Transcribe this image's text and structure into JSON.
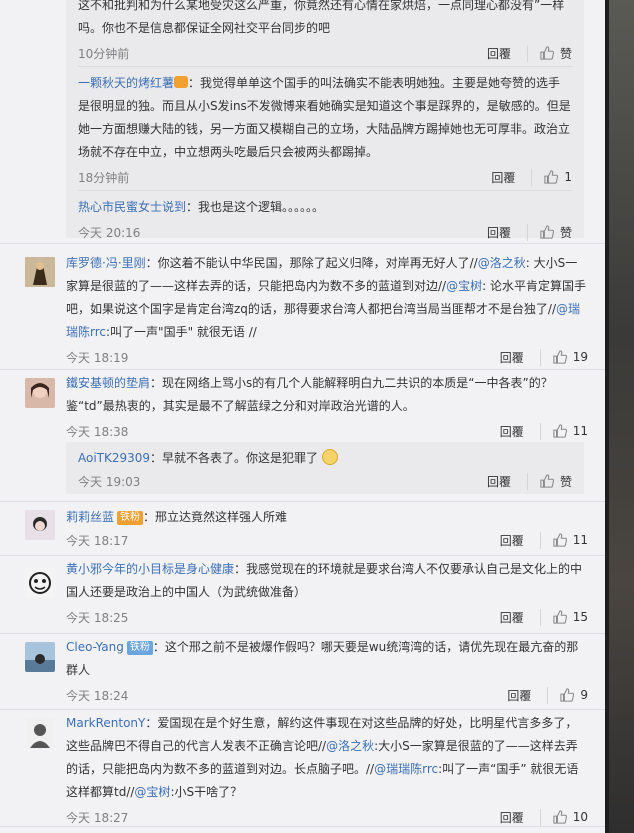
{
  "nested_top": {
    "items": [
      {
        "text": "这不和批判和为什么某地受灾这么严重，你竟然还有心情在家烘焙，一点同理心都没有”一样吗。你也不是信息都保证全网社交平台同步的吧",
        "time": "10分钟前",
        "reply": "回覆",
        "like": ""
      },
      {
        "user": "一颗秋天的烤红薯",
        "text": "：我觉得单单这个国手的叫法确实不能表明她独。主要是她夸赞的选手是很明显的独。而且从小S发ins不发微博来看她确实是知道这个事是踩界的，是敏感的。但是她一方面想赚大陆的钱，另一方面又模糊自己的立场，大陆品牌方踢掉她也无可厚非。政治立场就不存在中立，中立想两头吃最后只会被两头都踢掉。",
        "time": "18分钟前",
        "reply": "回覆",
        "like": "1"
      },
      {
        "user": "热心市民蜜女士说到",
        "text": "：我也是这个逻辑。。。。。。",
        "time": "今天 20:16",
        "reply": "回覆",
        "like": ""
      }
    ]
  },
  "comments": [
    {
      "user": "库罗德·冯·里刚",
      "text_a": "：你这着不能认中华民国，那除了起义归降，对岸再无好人了//",
      "mention1": "@洛之秋",
      "text_b": ": 大小S一家算是很蓝的了——这样去弄的话，只能把岛内为数不多的蓝道到对边//",
      "mention2": "@宝树",
      "text_c": ": 论水平肯定算国手吧，如果说这个国字是肯定台湾zq的话，那得要求台湾人都把台湾当局当匪帮才不是台独了//",
      "mention3": "@瑞瑞陈rrc",
      "text_d": ":叫了一声\"国手\" 就很无语 //",
      "time": "今天 18:19",
      "reply": "回覆",
      "like": "19"
    },
    {
      "user": "鐵安基顿的垫肩",
      "text": "：现在网络上骂小s的有几个人能解释明白九二共识的本质是“一中各表”的？鉴“td”最热衷的，其实是最不了解蓝绿之分和对岸政治光谱的人。",
      "time": "今天 18:38",
      "reply": "回覆",
      "like": "11",
      "sub": {
        "user": "AoiTK29309",
        "text": "：早就不各表了。你这是犯罪了",
        "time": "今天 19:03",
        "reply": "回覆",
        "like": ""
      }
    },
    {
      "user": "莉莉丝蓝",
      "badge": "铁粉",
      "text": "：邢立达竟然这样强人所难",
      "time": "今天 18:17",
      "reply": "回覆",
      "like": "11"
    },
    {
      "user": "黄小邪今年的小目标是身心健康",
      "text": "：我感觉现在的环境就是要求台湾人不仅要承认自己是文化上的中国人还要是政治上的中国人（为武统做准备）",
      "time": "今天 18:25",
      "reply": "回覆",
      "like": "15"
    },
    {
      "user": "Cleo-Yang",
      "badge": "铁粉",
      "text": "：这个邢之前不是被爆作假吗？哪天要是wu统湾湾的话，请优先现在最亢奋的那群人",
      "time": "今天 18:24",
      "reply": "回覆",
      "like": "9"
    },
    {
      "user": "MarkRentonY",
      "text_a": "：爱国现在是个好生意，解约这件事现在对这些品牌的好处，比明星代言多多了，这些品牌巴不得自己的代言人发表不正确言论吧//",
      "mention1": "@洛之秋",
      "text_b": ":大小S一家算是很蓝的了——这样去弄的话，只能把岛内为数不多的蓝道到对边。长点脑子吧。//",
      "mention2": "@瑞瑞陈rrc",
      "text_c": ":叫了一声“国手” 就很无语 这样都算td//",
      "mention3": "@宝树",
      "text_d": ":小S干啥了？",
      "time": "今天 18:27",
      "reply": "回覆",
      "like": "10"
    }
  ],
  "icons": {
    "thumb": "thumbs-up-icon"
  },
  "colors": {
    "link": "#eb7350",
    "mention": "#3b6fb6",
    "meta": "#808080"
  }
}
